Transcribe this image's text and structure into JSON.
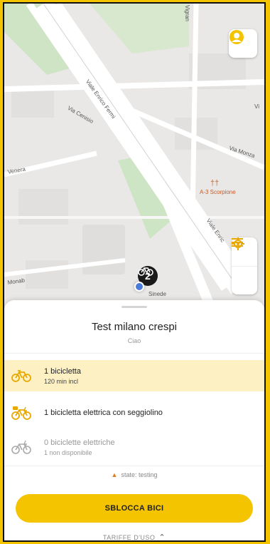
{
  "map": {
    "streets": {
      "viale_enrico_fermi": "Viale Enrico Fermi",
      "via_cenisio": "Via Cenisio",
      "via_monza": "Via Monza",
      "viale_enrico_2": "Viale Enric",
      "vigran": "Vigran",
      "via_left": "Venera",
      "via_bottom": "Monab",
      "via_right_edge": "Vi"
    },
    "poi": {
      "restaurant_label": "A-3 Scorpione",
      "restaurant_icon": "restaurant-icon"
    },
    "station_pin": {
      "count": "2",
      "icon": "bike-icon"
    },
    "station_pin_label": "Sinede",
    "controls": {
      "avatar_icon": "user-avatar-icon",
      "locate_icon": "locate-icon",
      "list_icon": "list-icon"
    }
  },
  "sheet": {
    "title": "Test milano crespi",
    "subtitle": "Ciao",
    "rows": [
      {
        "main": "1 bicicletta",
        "sub": "120 min incl",
        "icon": "bike-icon",
        "highlighted": true,
        "disabled": false
      },
      {
        "main": "1 bicicletta elettrica con seggiolino",
        "sub": "",
        "icon": "ebike-seat-icon",
        "highlighted": false,
        "disabled": false
      },
      {
        "main": "0 biciclette elettriche",
        "sub": "1 non disponibile",
        "icon": "ebike-icon",
        "highlighted": false,
        "disabled": true
      }
    ],
    "state_text": "state: testing",
    "state_icon": "flame-icon",
    "cta_label": "SBLOCCA BICI",
    "tariffs_label": "TARIFFE D'USO",
    "tariffs_icon": "chevron-up-icon"
  },
  "colors": {
    "brand_yellow": "#f5c400",
    "highlight_row": "#fdf1c4",
    "bike_icon": "#e8a800"
  }
}
